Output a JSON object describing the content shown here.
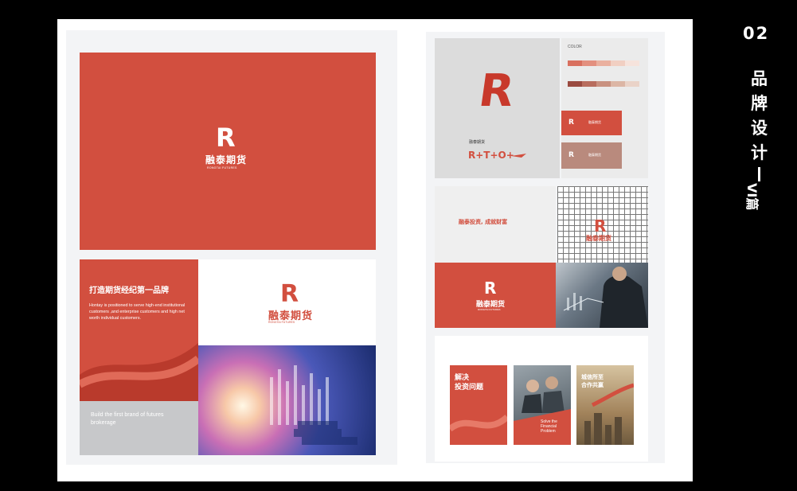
{
  "side_title": {
    "number": "02",
    "chars": [
      "品",
      "牌",
      "设",
      "计"
    ],
    "dash": "—",
    "sub": "VI篇"
  },
  "brand": {
    "logo_letter": "R",
    "name_cn": "融泰期货",
    "name_en": "RONGTAI FUTURES"
  },
  "left_panel": {
    "tagline": "打造期货经纪第一品牌",
    "description": "Hontay is positioned to serve high-end institutional customers ,and enterprise customers and high net worth individual customers.",
    "english_slogan": "Build the first brand of futures brokerage"
  },
  "right_panel": {
    "color_label": "COLOR",
    "brand_small_label": "融泰期货",
    "rto_text": "R+T+O+",
    "card_labels": [
      "融泰期货",
      "融泰期货"
    ],
    "slogan": "融泰投资, 成就财富",
    "posters": [
      {
        "title": "解决\n投资问题",
        "subtitle": ""
      },
      {
        "title": "",
        "subtitle": "Solve the\nFinancial\nProblem"
      },
      {
        "title": "城信所至\n合作共赢",
        "subtitle": ""
      }
    ]
  },
  "colors": {
    "brand_red": "#d24f3f",
    "swatches_row1": [
      "#d9705f",
      "#e3907f",
      "#eab09f",
      "#f1cfc2",
      "#f6e3dc"
    ],
    "swatches_row2": [
      "#9a4a40",
      "#b86d5e",
      "#c99180",
      "#dcb6a5",
      "#ead3c8"
    ]
  }
}
